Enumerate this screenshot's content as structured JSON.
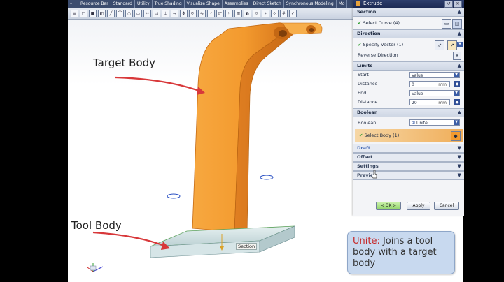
{
  "toolbar_tabs": [
    "Resource Bar",
    "Standard",
    "Utility",
    "True Shading",
    "Visualize Shape",
    "Assemblies",
    "Direct Sketch",
    "Synchronous Modeling",
    "Mo"
  ],
  "canvas": {
    "target_label": "Target Body",
    "tool_label": "Tool Body",
    "section_tag": "Section"
  },
  "dialog": {
    "title": "Extrude",
    "sections": {
      "section": "Section",
      "direction": "Direction",
      "limits": "Limits",
      "boolean": "Boolean",
      "draft": "Draft",
      "offset": "Offset",
      "settings": "Settings",
      "preview": "Preview"
    },
    "select_curve": "Select Curve (4)",
    "specify_vector": "Specify Vector (1)",
    "reverse_direction": "Reverse Direction",
    "start_label": "Start",
    "start_value": "Value",
    "start_distance_label": "Distance",
    "start_distance": "0",
    "end_label": "End",
    "end_value": "Value",
    "end_distance_label": "Distance",
    "end_distance": "20",
    "unit": "mm",
    "boolean_label": "Boolean",
    "boolean_value": "Unite",
    "select_body": "Select Body (1)",
    "ok": "< OK >",
    "apply": "Apply",
    "cancel": "Cancel"
  },
  "tooltip": {
    "keyword": "Unite:",
    "text": " Joins a tool body with a target body"
  },
  "colors": {
    "body_orange": "#f39a2e",
    "base_plate": "#d2e4e6",
    "tooltip_bg": "#c8d9ef",
    "keyword_red": "#c62828"
  }
}
